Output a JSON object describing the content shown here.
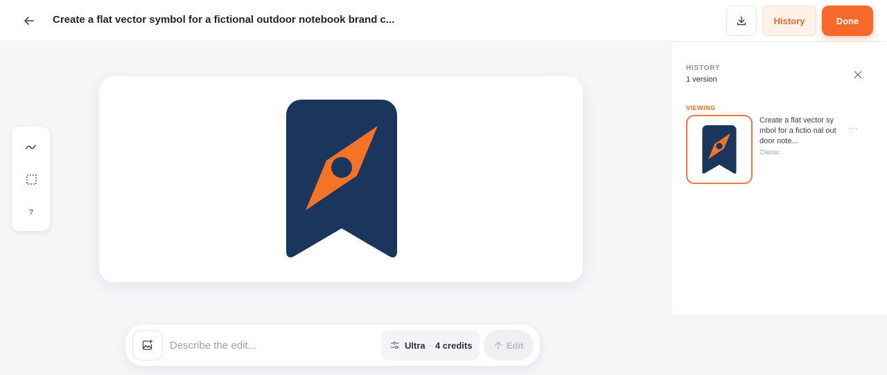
{
  "header": {
    "title": "Create a flat vector symbol for a fictional outdoor notebook brand c...",
    "history_label": "History",
    "done_label": "Done"
  },
  "toolbar": {
    "help_label": "?"
  },
  "prompt": {
    "placeholder": "Describe the edit...",
    "model": "Ultra",
    "separator": "·",
    "credits": "4 credits",
    "edit_label": "Edit"
  },
  "history": {
    "title": "HISTORY",
    "count": "1 version",
    "viewing_label": "VIEWING",
    "items": [
      {
        "description": "Create a flat vector symbol for a fictio nal outdoor note...",
        "style": "Classic"
      }
    ]
  },
  "colors": {
    "accent": "#f7692b",
    "navy": "#1a365d",
    "orange": "#f47326"
  },
  "icons": [
    "arrow-left-icon",
    "download-icon",
    "pen-line-icon",
    "selection-icon",
    "help-icon",
    "image-add-icon",
    "sliders-icon",
    "arrow-up-icon",
    "close-icon",
    "more-icon"
  ]
}
